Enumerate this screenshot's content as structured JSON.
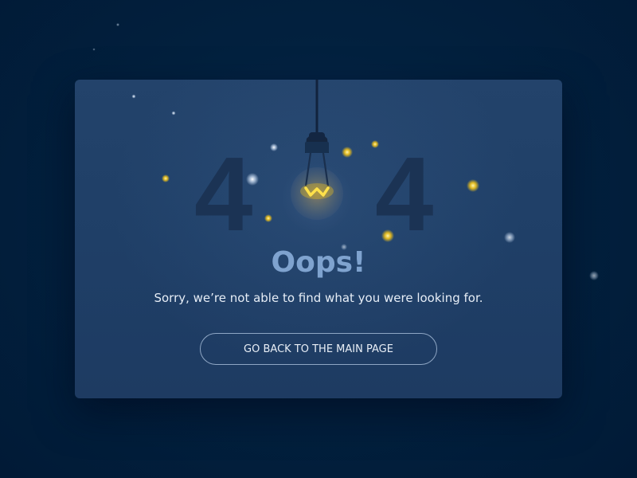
{
  "error_page": {
    "code_left": "4",
    "code_right": "4",
    "title": "Oops!",
    "message": "Sorry, we’re not able to find what you were looking for.",
    "button_label": "GO BACK TO THE MAIN PAGE"
  },
  "colors": {
    "background": "#011a36",
    "card": "#21406a",
    "digit": "#1b3354",
    "title": "#7fa3cf",
    "bulb_glow": "#f5c518",
    "button_border": "#8ea6c4"
  },
  "icons": {
    "bulb": "light-bulb-icon"
  }
}
